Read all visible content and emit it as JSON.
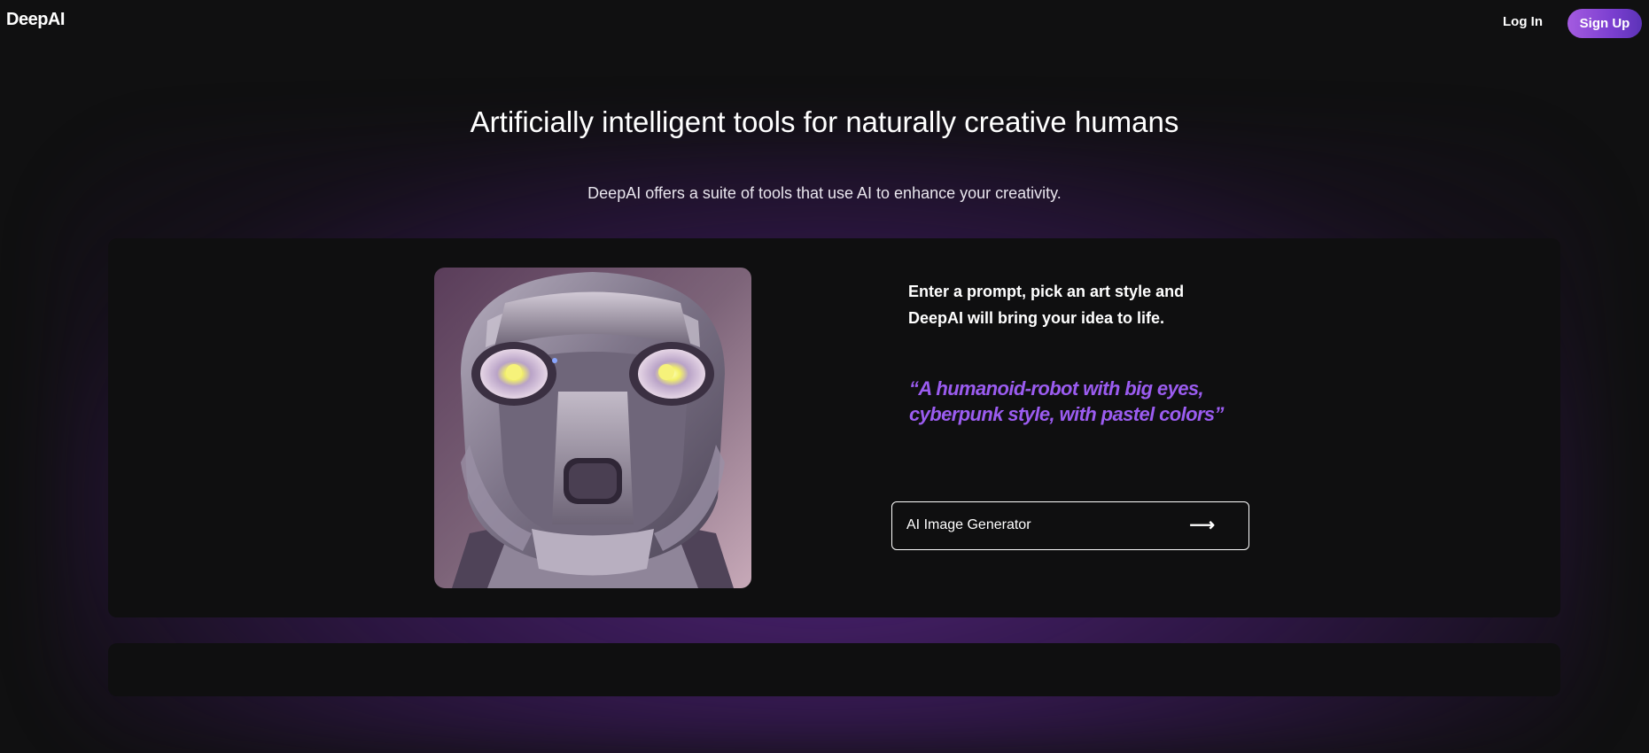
{
  "header": {
    "logo": "DeepAI",
    "login_label": "Log In",
    "signup_label": "Sign Up"
  },
  "hero": {
    "headline": "Artificially intelligent tools for naturally creative humans",
    "subline": "DeepAI offers a suite of tools that use AI to enhance your creativity."
  },
  "feature": {
    "description": "Enter a prompt, pick an art style and DeepAI will bring your idea to life.",
    "example_prompt": "“A humanoid-robot with big eyes, cyberpunk style, with pastel colors”",
    "cta_label": "AI Image Generator",
    "cta_icon": "arrow-right-icon",
    "image_subject": "robot-portrait"
  },
  "colors": {
    "background": "#101011",
    "card": "#0f0f10",
    "accent_purple": "#9b5cf0",
    "signup_gradient_start": "#a45be0",
    "signup_gradient_end": "#5c33b8"
  }
}
